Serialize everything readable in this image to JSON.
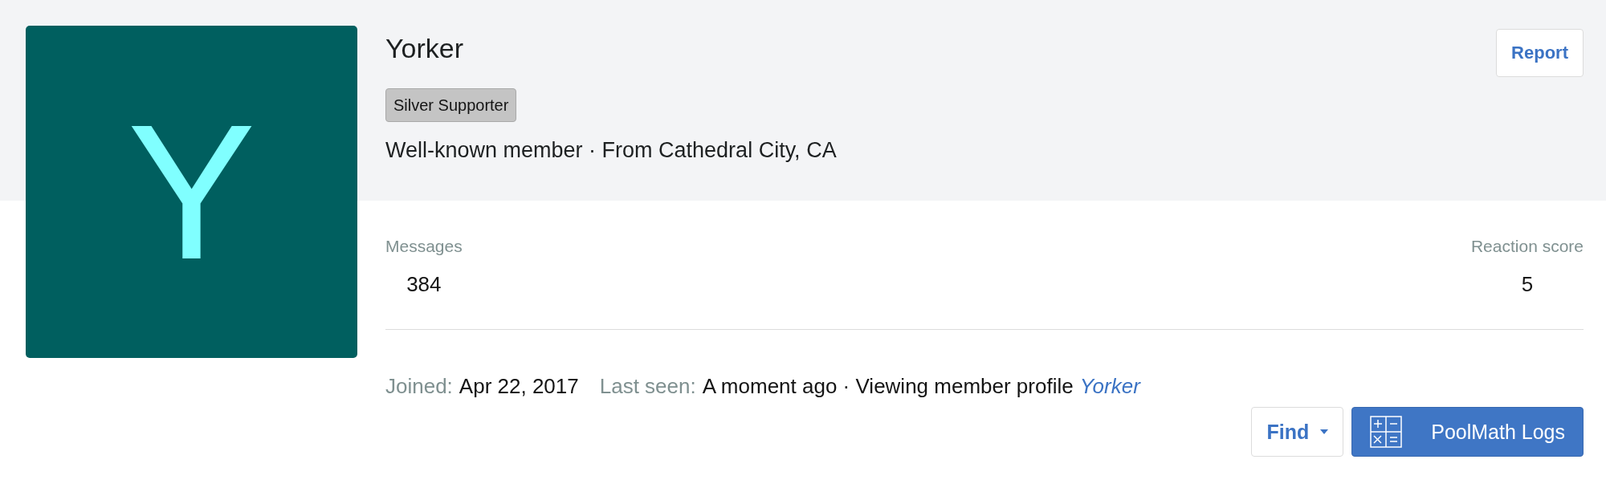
{
  "profile": {
    "avatar_letter": "Y",
    "name": "Yorker",
    "badge": "Silver Supporter",
    "subtitle": "Well-known member · From Cathedral City, CA"
  },
  "report_button": "Report",
  "stats": [
    {
      "label": "Messages",
      "value": "384"
    },
    {
      "label": "Reaction score",
      "value": "5"
    }
  ],
  "info": [
    {
      "label": "Joined:",
      "value": "Apr 22, 2017"
    },
    {
      "label": "Last seen:",
      "value": "A moment ago · Viewing member profile",
      "link": "Yorker"
    }
  ],
  "buttons": [
    {
      "kind": "dropdown",
      "label": "Find"
    },
    {
      "kind": "primary",
      "label": "PoolMath Logs"
    }
  ]
}
